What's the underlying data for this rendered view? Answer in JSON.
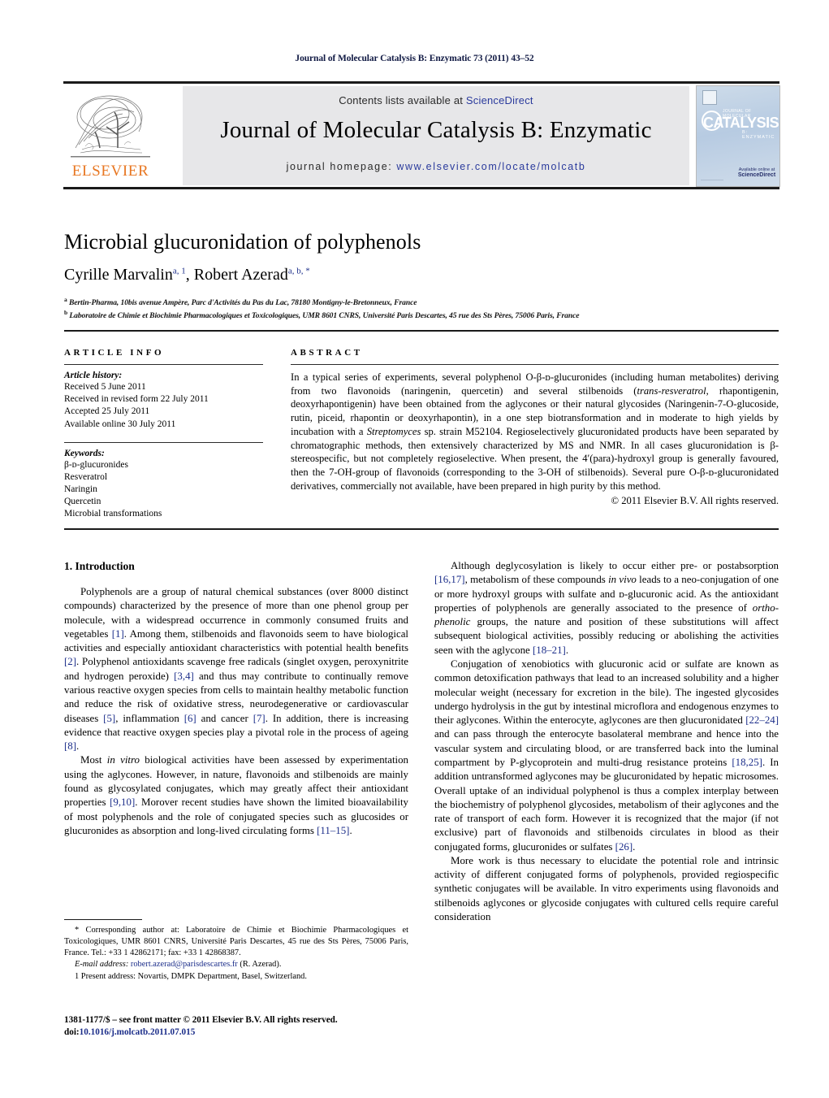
{
  "running_head": "Journal of Molecular Catalysis B: Enzymatic 73 (2011) 43–52",
  "masthead": {
    "contents_prefix": "Contents lists available at ",
    "sciencedirect": "ScienceDirect",
    "journal_title": "Journal of Molecular Catalysis B: Enzymatic",
    "homepage_prefix": "journal homepage: ",
    "homepage_url": "www.elsevier.com/locate/molcatb",
    "publisher_wordmark": "ELSEVIER",
    "publisher_color": "#e87722",
    "link_color": "#2a3a9c",
    "cover": {
      "line_top": "JOURNAL OF MOLECULAR",
      "title": "CATALYSIS",
      "subtitle": "B: ENZYMATIC",
      "footer_brand": "ScienceDirect",
      "footer_caption": "Available online at"
    }
  },
  "article": {
    "title": "Microbial glucuronidation of polyphenols",
    "authors_plain": "Cyrille Marvalin, Robert Azerad",
    "author1_name": "Cyrille Marvalin",
    "author1_marks": "a, 1",
    "author2_name": "Robert Azerad",
    "author2_marks": "a, b, *",
    "affiliation_a": "Bertin-Pharma, 10bis avenue Ampère, Parc d'Activités du Pas du Lac, 78180 Montigny-le-Bretonneux, France",
    "affiliation_b": "Laboratoire de Chimie et Biochimie Pharmacologiques et Toxicologiques, UMR 8601 CNRS, Université Paris Descartes, 45 rue des Sts Pères, 75006 Paris, France"
  },
  "article_info": {
    "heading": "ARTICLE INFO",
    "history_label": "Article history:",
    "history": [
      "Received 5 June 2011",
      "Received in revised form 22 July 2011",
      "Accepted 25 July 2011",
      "Available online 30 July 2011"
    ],
    "keywords_label": "Keywords:",
    "keywords": [
      "β-ᴅ-glucuronides",
      "Resveratrol",
      "Naringin",
      "Quercetin",
      "Microbial transformations"
    ]
  },
  "abstract": {
    "heading": "ABSTRACT",
    "text": "In a typical series of experiments, several polyphenol O-β-ᴅ-glucuronides (including human metabolites) deriving from two flavonoids (naringenin, quercetin) and several stilbenoids (trans-resveratrol, rhapontigenin, deoxyrhapontigenin) have been obtained from the aglycones or their natural glycosides (Naringenin-7-O-glucoside, rutin, piceid, rhapontin or deoxyrhapontin), in a one step biotransformation and in moderate to high yields by incubation with a Streptomyces sp. strain M52104. Regioselectively glucuronidated products have been separated by chromatographic methods, then extensively characterized by MS and NMR. In all cases glucuronidation is β-stereospecific, but not completely regioselective. When present, the 4′(para)-hydroxyl group is generally favoured, then the 7-OH-group of flavonoids (corresponding to the 3-OH of stilbenoids). Several pure O-β-ᴅ-glucuronidated derivatives, commercially not available, have been prepared in high purity by this method.",
    "copyright": "© 2011 Elsevier B.V. All rights reserved."
  },
  "sections": {
    "intro_heading": "1. Introduction",
    "left_paragraphs": [
      "Polyphenols are a group of natural chemical substances (over 8000 distinct compounds) characterized by the presence of more than one phenol group per molecule, with a widespread occurrence in commonly consumed fruits and vegetables [1]. Among them, stilbenoids and flavonoids seem to have biological activities and especially antioxidant characteristics with potential health benefits [2]. Polyphenol antioxidants scavenge free radicals (singlet oxygen, peroxynitrite and hydrogen peroxide) [3,4] and thus may contribute to continually remove various reactive oxygen species from cells to maintain healthy metabolic function and reduce the risk of oxidative stress, neurodegenerative or cardiovascular diseases [5], inflammation [6] and cancer [7]. In addition, there is increasing evidence that reactive oxygen species play a pivotal role in the process of ageing [8].",
      "Most in vitro biological activities have been assessed by experimentation using the aglycones. However, in nature, flavonoids and stilbenoids are mainly found as glycosylated conjugates, which may greatly affect their antioxidant properties [9,10]. Morover recent studies have shown the limited bioavailability of most polyphenols and the role of conjugated species such as glucosides or glucuronides as absorption and long-lived circulating forms [11–15]."
    ],
    "right_paragraphs": [
      "Although deglycosylation is likely to occur either pre- or postabsorption [16,17], metabolism of these compounds in vivo leads to a neo-conjugation of one or more hydroxyl groups with sulfate and ᴅ-glucuronic acid. As the antioxidant properties of polyphenols are generally associated to the presence of ortho-phenolic groups, the nature and position of these substitutions will affect subsequent biological activities, possibly reducing or abolishing the activities seen with the aglycone [18–21].",
      "Conjugation of xenobiotics with glucuronic acid or sulfate are known as common detoxification pathways that lead to an increased solubility and a higher molecular weight (necessary for excretion in the bile). The ingested glycosides undergo hydrolysis in the gut by intestinal microflora and endogenous enzymes to their aglycones. Within the enterocyte, aglycones are then glucuronidated [22–24] and can pass through the enterocyte basolateral membrane and hence into the vascular system and circulating blood, or are transferred back into the luminal compartment by P-glycoprotein and multi-drug resistance proteins [18,25]. In addition untransformed aglycones may be glucuronidated by hepatic microsomes. Overall uptake of an individual polyphenol is thus a complex interplay between the biochemistry of polyphenol glycosides, metabolism of their aglycones and the rate of transport of each form. However it is recognized that the major (if not exclusive) part of flavonoids and stilbenoids circulates in blood as their conjugated forms, glucuronides or sulfates [26].",
      "More work is thus necessary to elucidate the potential role and intrinsic activity of different conjugated forms of polyphenols, provided regiospecific synthetic conjugates will be available. In vitro experiments using flavonoids and stilbenoids aglycones or glycoside conjugates with cultured cells require careful consideration"
    ]
  },
  "footnotes": {
    "corresponding": "* Corresponding author at: Laboratoire de Chimie et Biochimie Pharmacologiques et Toxicologiques, UMR 8601 CNRS, Université Paris Descartes, 45 rue des Sts Pères, 75006 Paris, France. Tel.: +33 1 42862171; fax: +33 1 42868387.",
    "email_label": "E-mail address:",
    "email": "robert.azerad@parisdescartes.fr",
    "email_owner": "(R. Azerad).",
    "present_address": "1 Present address: Novartis, DMPK Department, Basel, Switzerland."
  },
  "imprint": {
    "issn_line": "1381-1177/$ – see front matter © 2011 Elsevier B.V. All rights reserved.",
    "doi_prefix": "doi:",
    "doi": "10.1016/j.molcatb.2011.07.015"
  }
}
